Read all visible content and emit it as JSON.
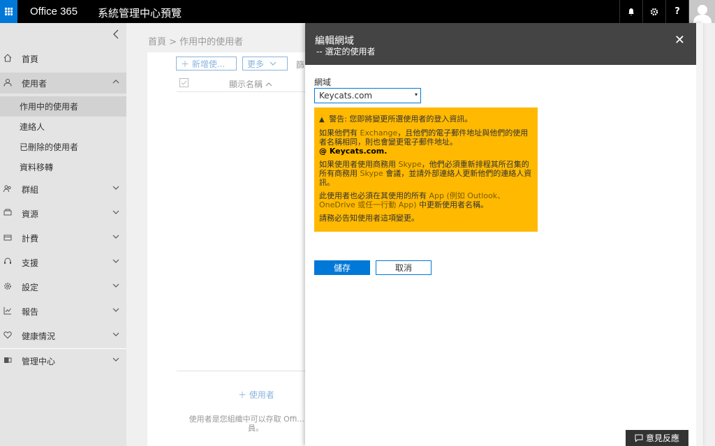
{
  "topbar": {
    "brand": "Office 365",
    "app_title": "系統管理中心預覽",
    "icons": [
      "waffle-icon",
      "bell-icon",
      "gear-icon",
      "help-icon",
      "avatar"
    ],
    "help_label": "?"
  },
  "sidebar": {
    "items": [
      {
        "label": "首頁",
        "icon": "home-icon"
      },
      {
        "label": "使用者",
        "icon": "user-icon"
      },
      {
        "label": "群組",
        "icon": "group-icon"
      },
      {
        "label": "資源",
        "icon": "resource-icon"
      },
      {
        "label": "計費",
        "icon": "billing-icon"
      },
      {
        "label": "支援",
        "icon": "support-icon"
      },
      {
        "label": "設定",
        "icon": "settings-icon"
      },
      {
        "label": "報告",
        "icon": "report-icon"
      },
      {
        "label": "健康情況",
        "icon": "health-icon"
      },
      {
        "label": "管理中心",
        "icon": "admin-center-icon"
      }
    ],
    "sub_items": [
      "作用中的使用者",
      "連絡人",
      "已刪除的使用者",
      "資料移轉"
    ]
  },
  "main": {
    "breadcrumb": "首頁 > 作用中的使用者",
    "add_button": "＋ 新增使...",
    "more_button": "更多",
    "filter_label": "篩",
    "column_display_name": "顯示名稱",
    "empty_add": "＋ 使用者",
    "empty_desc": "使用者是您組織中可以存取 Offi... 的人員。"
  },
  "panel": {
    "title": "編輯網域",
    "subtitle": "-- 選定的使用者",
    "close_label": "✕",
    "field_label": "網域",
    "domain_value": "Keycats.com",
    "warning": {
      "heading": "警告: 您即將變更所選使用者的登入資訊。",
      "p1_a": "如果他們有 ",
      "p1_hl": "Exchange",
      "p1_b": "，且他們的電子郵件地址與他們的使用者名稱相同，則也會變更電子郵件地址。",
      "p1_domain": "@ Keycats.com.",
      "p2_a": "如果使用者使用商務用 ",
      "p2_hl1": "Skype",
      "p2_b": "，他們必須重新排程其所召集的所有商務用 ",
      "p2_hl2": "Skype",
      "p2_c": " 會議，並請外部連絡人更新他們的連絡人資訊。",
      "p3_a": "此使用者也必須在其使用的所有 ",
      "p3_hl": "App (例如 Outlook、OneDrive 或任一行動 App)",
      "p3_b": " 中更新使用者名稱。",
      "p4": "請務必告知使用者這項變更。"
    },
    "save_button": "儲存",
    "cancel_button": "取消"
  },
  "feedback": {
    "label": "意見反應"
  },
  "colors": {
    "topbar_bg": "#000000",
    "accent": "#0078d7",
    "warning_bg": "#ffb900",
    "panel_header_bg": "#444444"
  }
}
